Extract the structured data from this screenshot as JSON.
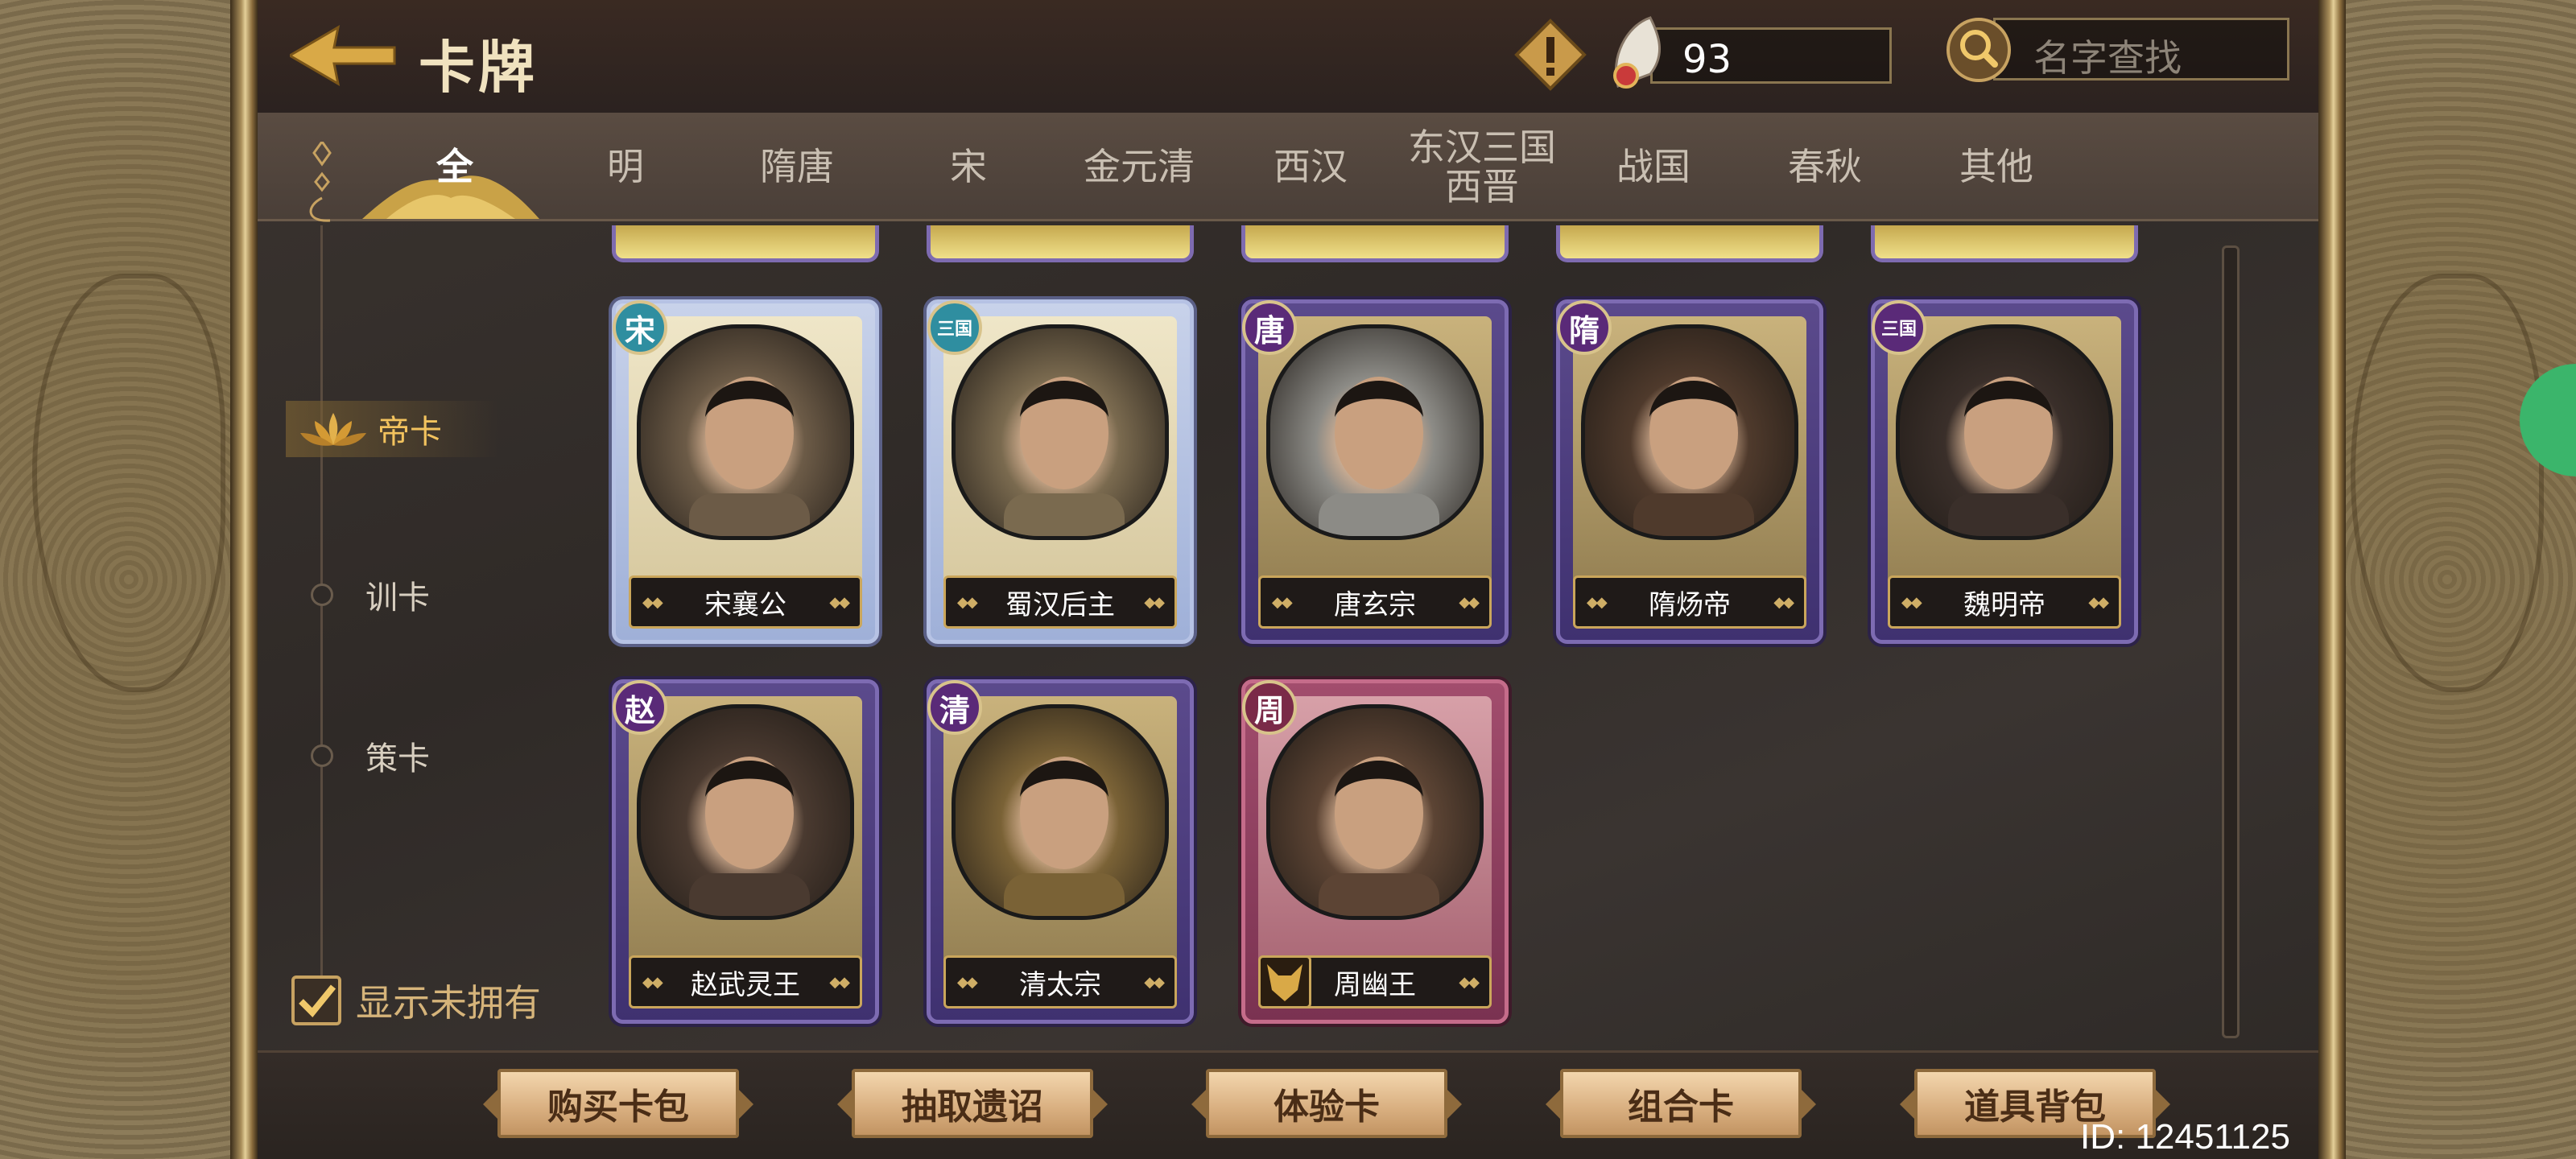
{
  "header": {
    "title": "卡牌",
    "currency_value": "93",
    "search_placeholder": "名字查找"
  },
  "tabs": [
    {
      "label": "全",
      "active": true
    },
    {
      "label": "明"
    },
    {
      "label": "隋唐"
    },
    {
      "label": "宋"
    },
    {
      "label": "金元清"
    },
    {
      "label": "西汉"
    },
    {
      "label": "东汉三国\n西晋"
    },
    {
      "label": "战国"
    },
    {
      "label": "春秋"
    },
    {
      "label": "其他"
    }
  ],
  "categories": [
    {
      "label": "帝卡",
      "active": true
    },
    {
      "label": "训卡"
    },
    {
      "label": "策卡"
    }
  ],
  "show_unowned_label": "显示未拥有",
  "show_unowned_checked": true,
  "cards": [
    {
      "name": "宋襄公",
      "era": "宋",
      "frame": "blue",
      "portrait_color": "#6c5b47"
    },
    {
      "name": "蜀汉后主",
      "era": "三国",
      "frame": "blue",
      "portrait_color": "#7a6a4f"
    },
    {
      "name": "唐玄宗",
      "era": "唐",
      "frame": "purple",
      "portrait_color": "#8c8b86"
    },
    {
      "name": "隋炀帝",
      "era": "隋",
      "frame": "purple",
      "portrait_color": "#4f3a2c"
    },
    {
      "name": "魏明帝",
      "era": "三国",
      "frame": "purple",
      "portrait_color": "#3a2f2a"
    },
    {
      "name": "赵武灵王",
      "era": "赵",
      "frame": "purple",
      "portrait_color": "#4a3a30"
    },
    {
      "name": "清太宗",
      "era": "清",
      "frame": "purple",
      "portrait_color": "#7a6236"
    },
    {
      "name": "周幽王",
      "era": "周",
      "frame": "red",
      "portrait_color": "#5c4434"
    }
  ],
  "bottom_buttons": [
    "购买卡包",
    "抽取遗诏",
    "体验卡",
    "组合卡",
    "道具背包"
  ],
  "user_id": "ID: 12451125"
}
